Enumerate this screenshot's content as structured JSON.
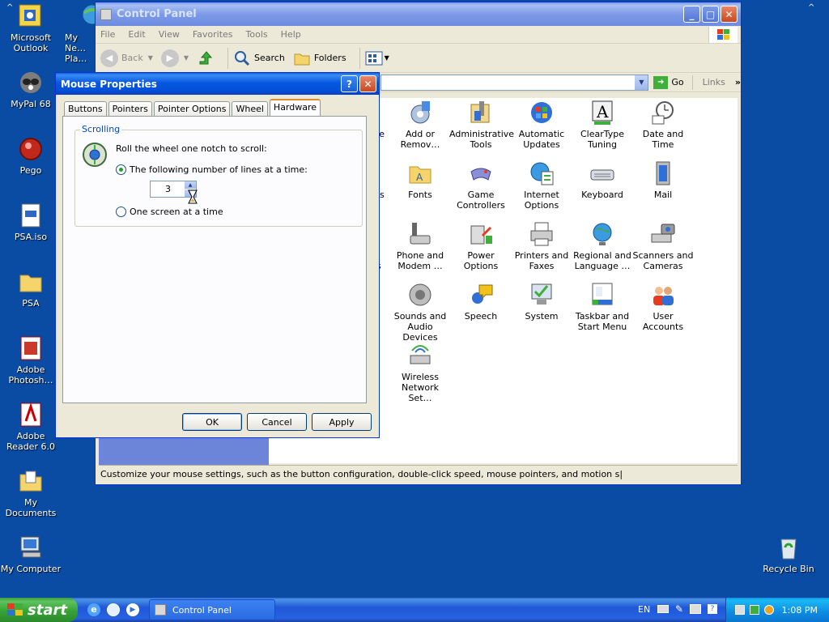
{
  "desktop": {
    "icons": [
      {
        "label": "Microsoft Outlook"
      },
      {
        "label": "My Ne… Pla…"
      },
      {
        "label": "MyPal 68"
      },
      {
        "label": "Pego"
      },
      {
        "label": "PSA.iso"
      },
      {
        "label": "PSA"
      },
      {
        "label": "Adobe Photosh…"
      },
      {
        "label": "Adobe Reader 6.0"
      },
      {
        "label": "My Documents"
      },
      {
        "label": "My Computer"
      },
      {
        "label": "Recycle Bin"
      }
    ]
  },
  "control_panel": {
    "title": "Control Panel",
    "menu": [
      "File",
      "Edit",
      "View",
      "Favorites",
      "Tools",
      "Help"
    ],
    "toolbar": {
      "back": "Back",
      "search": "Search",
      "folders": "Folders"
    },
    "address": {
      "go": "Go",
      "links": "Links"
    },
    "partial_labels": [
      "re",
      "ns",
      "s"
    ],
    "items": [
      {
        "label": "Add or Remov…"
      },
      {
        "label": "Administrative Tools"
      },
      {
        "label": "Automatic Updates"
      },
      {
        "label": "ClearType Tuning"
      },
      {
        "label": "Date and Time"
      },
      {
        "label": "Fonts"
      },
      {
        "label": "Game Controllers"
      },
      {
        "label": "Internet Options"
      },
      {
        "label": "Keyboard"
      },
      {
        "label": "Mail"
      },
      {
        "label": "Phone and Modem …"
      },
      {
        "label": "Power Options"
      },
      {
        "label": "Printers and Faxes"
      },
      {
        "label": "Regional and Language …"
      },
      {
        "label": "Scanners and Cameras"
      },
      {
        "label": "Sounds and Audio Devices"
      },
      {
        "label": "Speech"
      },
      {
        "label": "System"
      },
      {
        "label": "Taskbar and Start Menu"
      },
      {
        "label": "User Accounts"
      },
      {
        "label": "Wireless Network Set…"
      }
    ],
    "status": "Customize your mouse settings, such as the button configuration, double-click speed, mouse pointers, and motion s|"
  },
  "dialog": {
    "title": "Mouse Properties",
    "tabs": [
      "Buttons",
      "Pointers",
      "Pointer Options",
      "Wheel",
      "Hardware"
    ],
    "active_tab": "Hardware",
    "group_title": "Scrolling",
    "instruction": "Roll the wheel one notch to scroll:",
    "option_lines": "The following number of lines at a time:",
    "lines_value": "3",
    "option_screen": "One screen at a time",
    "selected_option": "lines",
    "buttons": {
      "ok": "OK",
      "cancel": "Cancel",
      "apply": "Apply"
    }
  },
  "taskbar": {
    "start": "start",
    "active_task": "Control Panel",
    "language": "EN",
    "clock": "1:08 PM"
  }
}
